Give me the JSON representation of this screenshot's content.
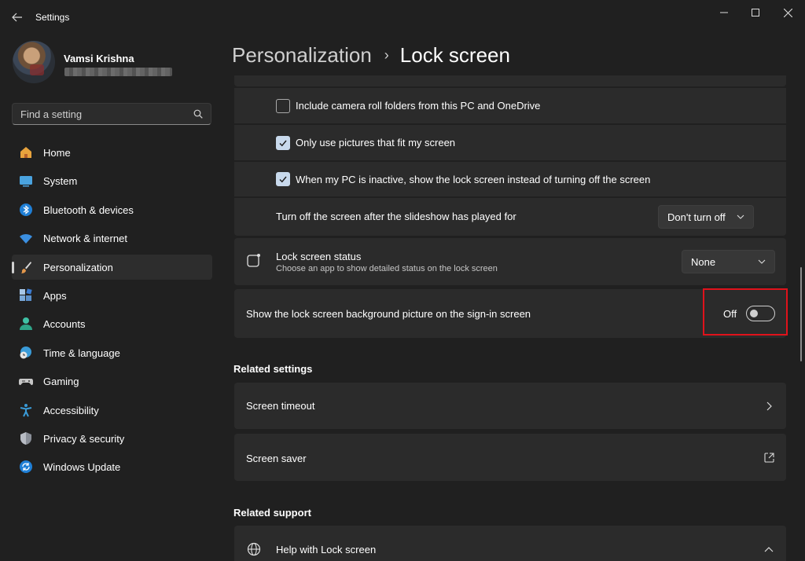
{
  "window": {
    "title": "Settings"
  },
  "profile": {
    "name": "Vamsi Krishna"
  },
  "search": {
    "placeholder": "Find a setting"
  },
  "nav": {
    "items": [
      {
        "label": "Home",
        "icon": "home-icon"
      },
      {
        "label": "System",
        "icon": "system-icon"
      },
      {
        "label": "Bluetooth & devices",
        "icon": "bluetooth-icon"
      },
      {
        "label": "Network & internet",
        "icon": "wifi-icon"
      },
      {
        "label": "Personalization",
        "icon": "brush-icon",
        "active": true
      },
      {
        "label": "Apps",
        "icon": "apps-icon"
      },
      {
        "label": "Accounts",
        "icon": "person-icon"
      },
      {
        "label": "Time & language",
        "icon": "globe-clock-icon"
      },
      {
        "label": "Gaming",
        "icon": "gamepad-icon"
      },
      {
        "label": "Accessibility",
        "icon": "accessibility-icon"
      },
      {
        "label": "Privacy & security",
        "icon": "shield-icon"
      },
      {
        "label": "Windows Update",
        "icon": "update-icon"
      }
    ]
  },
  "breadcrumb": {
    "parent": "Personalization",
    "separator": "›",
    "current": "Lock screen"
  },
  "slideshow": {
    "camera_roll_label": "Include camera roll folders from this PC and OneDrive",
    "camera_roll_checked": false,
    "fit_screen_label": "Only use pictures that fit my screen",
    "fit_screen_checked": true,
    "inactive_label": "When my PC is inactive, show the lock screen instead of turning off the screen",
    "inactive_checked": true,
    "turn_off_label": "Turn off the screen after the slideshow has played for",
    "turn_off_value": "Don't turn off"
  },
  "lock_status": {
    "title": "Lock screen status",
    "description": "Choose an app to show detailed status on the lock screen",
    "value": "None"
  },
  "signin_background": {
    "label": "Show the lock screen background picture on the sign-in screen",
    "state_label": "Off",
    "enabled": false
  },
  "related_settings": {
    "title": "Related settings",
    "screen_timeout": "Screen timeout",
    "screen_saver": "Screen saver"
  },
  "related_support": {
    "title": "Related support",
    "help": "Help with Lock screen"
  },
  "colors": {
    "background": "#202020",
    "card": "#2b2b2b",
    "checkbox_checked": "#c8d9ec",
    "highlight": "#e0121b"
  }
}
